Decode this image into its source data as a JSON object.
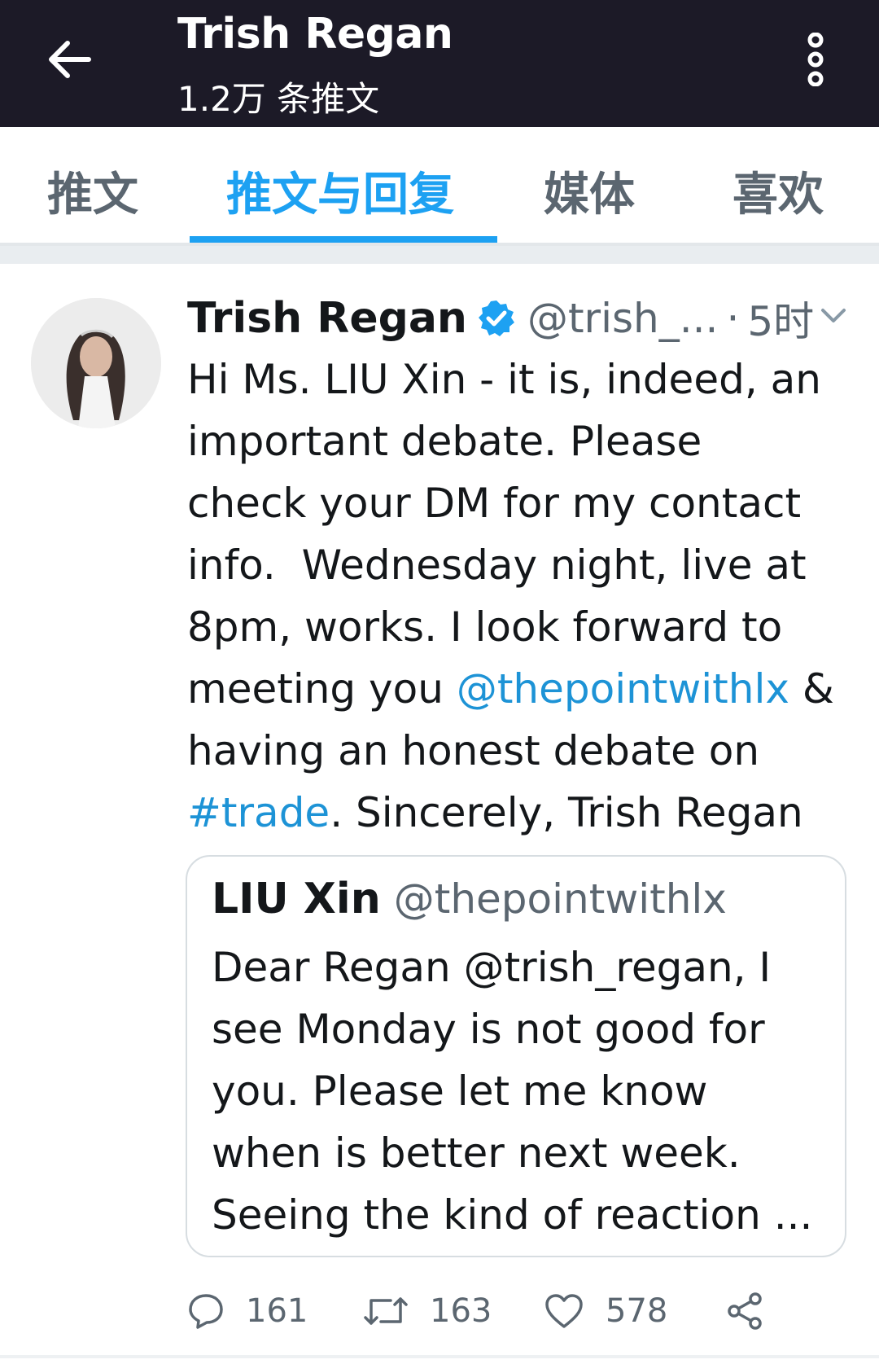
{
  "header": {
    "title": "Trish Regan",
    "subtitle": "1.2万 条推文",
    "back_icon": "arrow-left-icon",
    "more_icon": "more-vertical-icon",
    "background": "#1c1a27"
  },
  "tabs": [
    {
      "label": "推文",
      "active": false
    },
    {
      "label": "推文与回复",
      "active": true
    },
    {
      "label": "媒体",
      "active": false
    },
    {
      "label": "喜欢",
      "active": false
    }
  ],
  "accent_color": "#1da1f2",
  "tweet": {
    "author_name": "Trish Regan",
    "verified": true,
    "handle": "@trish_...",
    "separator": "·",
    "time": "5时",
    "lines": {
      "l1": "Hi Ms. LIU Xin - it is, indeed, an",
      "l2": "important debate. Please",
      "l3": "check your DM for my contact",
      "l4": "info.  Wednesday night, live at",
      "l5": "8pm, works. I look forward to",
      "l6_pre": "meeting you ",
      "l6_mention": "@thepointwithlx",
      "l6_post": " &",
      "l7": "having an honest debate on",
      "l8_hashtag": "#trade",
      "l8_post": ". Sincerely, Trish Regan"
    },
    "quoted": {
      "name": "LIU Xin",
      "handle": "@thepointwithlx",
      "lines": [
        "Dear Regan @trish_regan, I",
        "see Monday is not good for",
        "you. Please let me know",
        "when is better next week.",
        "Seeing the kind of reaction ..."
      ]
    },
    "actions": {
      "replies": "161",
      "retweets": "163",
      "likes": "578"
    }
  }
}
